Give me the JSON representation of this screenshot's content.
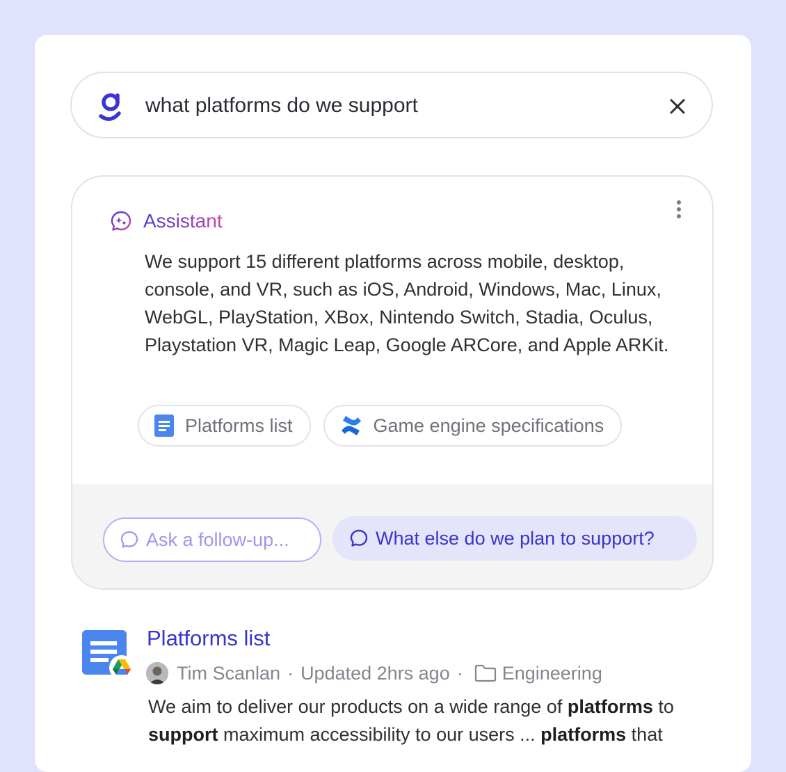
{
  "search": {
    "query": "what platforms do we support"
  },
  "assistant": {
    "title": "Assistant",
    "answer": "We support 15 different platforms across mobile, desktop, console, and VR, such as iOS, Android, Windows, Mac, Linux, WebGL, PlayStation, XBox, Nintendo Switch, Stadia, Oculus, Playstation VR, Magic Leap, Google ARCore, and Apple ARKit.",
    "sources": [
      {
        "label": "Platforms list",
        "icon": "google-docs-icon"
      },
      {
        "label": "Game engine specifications",
        "icon": "confluence-icon"
      }
    ],
    "followup_placeholder": "Ask a follow-up...",
    "suggestion": "What else do we plan to support?"
  },
  "result": {
    "title": "Platforms list",
    "author": "Tim Scanlan",
    "updated": "Updated 2hrs ago",
    "folder": "Engineering",
    "snippet_parts": [
      "We aim to deliver our products on a wide range of ",
      "platforms",
      " to ",
      "support",
      " maximum accessibility to our users ... ",
      "platforms",
      " that"
    ]
  },
  "colors": {
    "page_background": "#e1e2fd",
    "accent": "#3a33cf",
    "assistant_gradient": [
      "#4b3fd6",
      "#c8429e"
    ]
  }
}
